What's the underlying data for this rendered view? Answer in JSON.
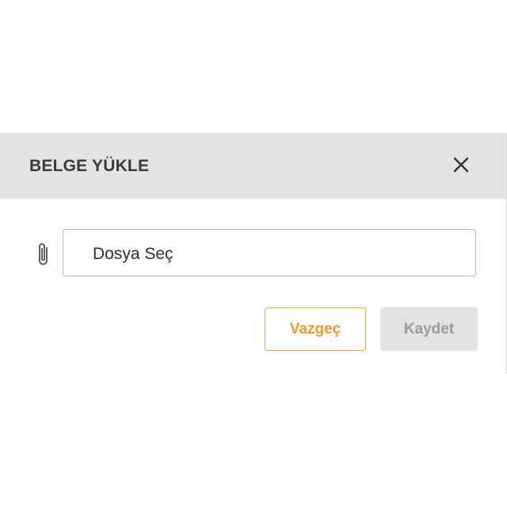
{
  "dialog": {
    "title": "BELGE YÜKLE",
    "close_icon": "close-icon",
    "attachment_icon": "paperclip-icon",
    "file_input": {
      "label": "Dosya Seç"
    },
    "buttons": {
      "cancel_label": "Vazgeç",
      "save_label": "Kaydet"
    }
  },
  "colors": {
    "header_background": "#e3e3e3",
    "accent": "#ee9a26",
    "disabled_button_background": "#e3e3e3",
    "disabled_button_text": "#9d9d9d"
  }
}
